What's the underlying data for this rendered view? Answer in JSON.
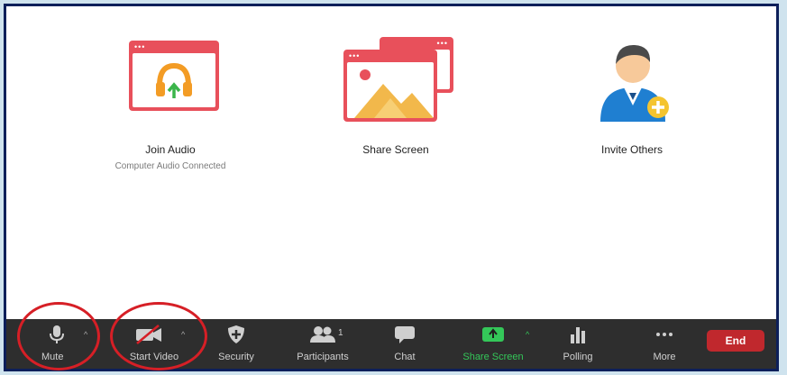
{
  "options": {
    "join_audio": {
      "title": "Join Audio",
      "subtitle": "Computer Audio Connected"
    },
    "share_screen": {
      "title": "Share Screen"
    },
    "invite_others": {
      "title": "Invite Others"
    }
  },
  "toolbar": {
    "mute_label": "Mute",
    "start_video_label": "Start Video",
    "security_label": "Security",
    "participants_label": "Participants",
    "participants_count": "1",
    "chat_label": "Chat",
    "share_screen_label": "Share Screen",
    "polling_label": "Polling",
    "more_label": "More",
    "end_label": "End"
  },
  "icons": {
    "audio": "headphones-icon",
    "share": "share-screen-icon",
    "invite": "invite-person-icon",
    "mute": "microphone-icon",
    "video": "video-off-icon",
    "security": "shield-icon",
    "participants": "participants-icon",
    "chat": "chat-bubble-icon",
    "share_toolbar": "share-screen-arrow-icon",
    "polling": "bar-chart-icon",
    "more": "more-dots-icon"
  },
  "colors": {
    "accent_red": "#e8505b",
    "toolbar_bg": "#2e2e2e",
    "share_green": "#34c759",
    "end_red": "#c0282d",
    "annotation_circle": "#d61f26"
  }
}
